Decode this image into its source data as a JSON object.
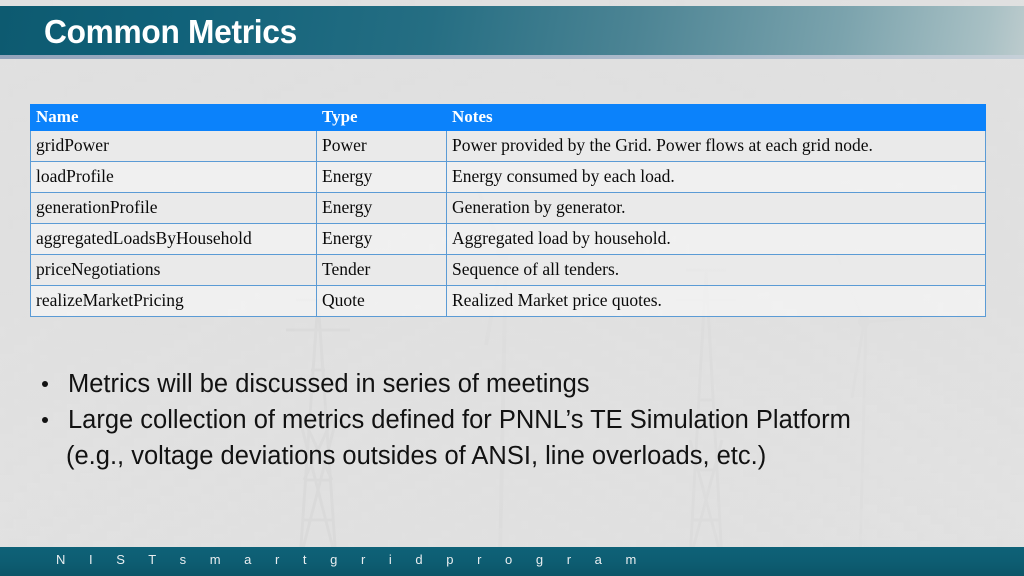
{
  "slide": {
    "title": "Common Metrics",
    "background_color": "#e8e8e8",
    "title_band_color_left": "#0d5a70",
    "title_band_color_right": "#bccbcd"
  },
  "table": {
    "header_color": "#0b82fb",
    "border_color": "#5b9bd5",
    "columns": [
      "Name",
      "Type",
      "Notes"
    ],
    "rows": [
      {
        "name": "gridPower",
        "type": "Power",
        "notes": "Power provided by the Grid. Power flows at each grid node."
      },
      {
        "name": "loadProfile",
        "type": "Energy",
        "notes": "Energy consumed by each load."
      },
      {
        "name": "generationProfile",
        "type": "Energy",
        "notes": "Generation by generator."
      },
      {
        "name": "aggregatedLoadsByHousehold",
        "type": "Energy",
        "notes": "Aggregated load by household."
      },
      {
        "name": "priceNegotiations",
        "type": "Tender",
        "notes": "Sequence of all tenders."
      },
      {
        "name": "realizeMarketPricing",
        "type": "Quote",
        "notes": "Realized Market price quotes."
      }
    ]
  },
  "bullets": [
    {
      "text": "Metrics will be discussed in series of meetings",
      "line2": ""
    },
    {
      "text": "Large collection of metrics defined for PNNL’s TE Simulation Platform",
      "line2": "(e.g., voltage deviations outsides of ANSI, line overloads, etc.)"
    }
  ],
  "footer": {
    "text": "N I S T     s m a r t     g r i d     p r o g r a m",
    "band_color": "#0d5d72"
  }
}
